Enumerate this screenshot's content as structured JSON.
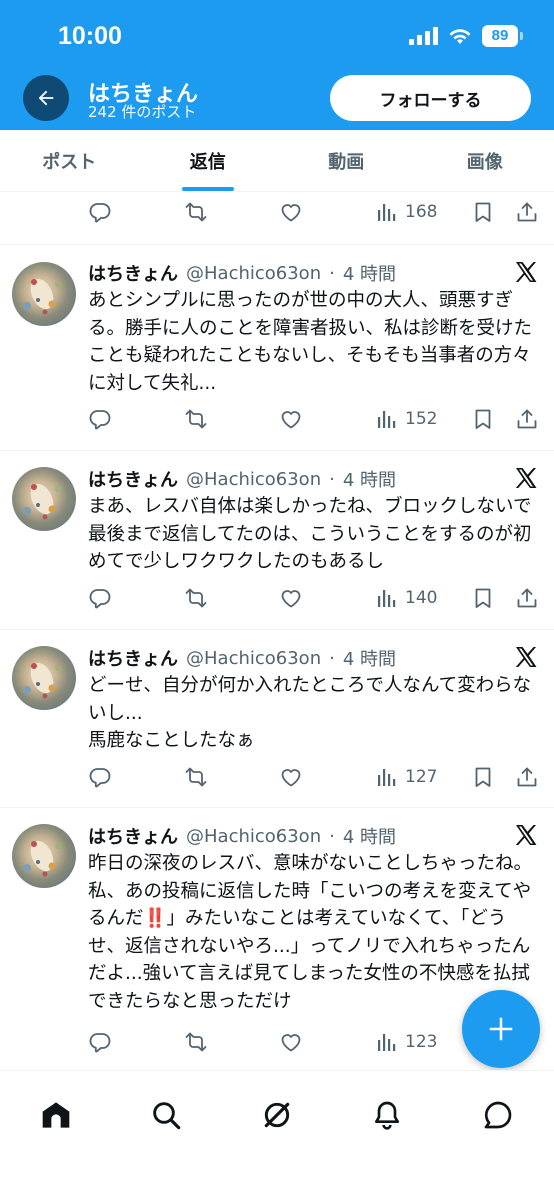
{
  "status_bar": {
    "time": "10:00",
    "battery": "89"
  },
  "profile": {
    "name": "はちきょん",
    "post_count": "242 件のポスト",
    "follow_label": "フォローする"
  },
  "tabs": [
    {
      "label": "ポスト",
      "active": false
    },
    {
      "label": "返信",
      "active": true
    },
    {
      "label": "動画",
      "active": false
    },
    {
      "label": "画像",
      "active": false
    }
  ],
  "top_partial_post": {
    "views": "168"
  },
  "posts": [
    {
      "author": "はちきょん",
      "handle": "@Hachico63on",
      "time": "4 時間",
      "text": "あとシンプルに思ったのが世の中の大人、頭悪すぎる。勝手に人のことを障害者扱い、私は診断を受けたことも疑われたこともないし、そもそも当事者の方々に対して失礼...",
      "views": "152"
    },
    {
      "author": "はちきょん",
      "handle": "@Hachico63on",
      "time": "4 時間",
      "text": "まあ、レスバ自体は楽しかったね、ブロックしないで最後まで返信してたのは、こういうことをするのが初めてで少しワクワクしたのもあるし",
      "views": "140"
    },
    {
      "author": "はちきょん",
      "handle": "@Hachico63on",
      "time": "4 時間",
      "text": "どーせ、自分が何か入れたところで人なんて変わらないし...\n馬鹿なことしたなぁ",
      "views": "127"
    },
    {
      "author": "はちきょん",
      "handle": "@Hachico63on",
      "time": "4 時間",
      "text": "昨日の深夜のレスバ、意味がないことしちゃったね。私、あの投稿に返信した時「こいつの考えを変えてやるんだ‼️」みたいなことは考えていなくて、「どうせ、返信されないやろ...」ってノリで入れちゃったんだよ...強いて言えば見てしまった女性の不快感を払拭できたらなと思っただけ",
      "views": "123"
    }
  ],
  "colors": {
    "brand": "#1d9bf0",
    "text": "#0f1419",
    "muted": "#536471"
  },
  "icons": {
    "reply": "reply-icon",
    "repost": "repost-icon",
    "like": "like-icon",
    "views": "views-icon",
    "bookmark": "bookmark-icon",
    "share": "share-icon",
    "x": "x-logo-icon"
  }
}
